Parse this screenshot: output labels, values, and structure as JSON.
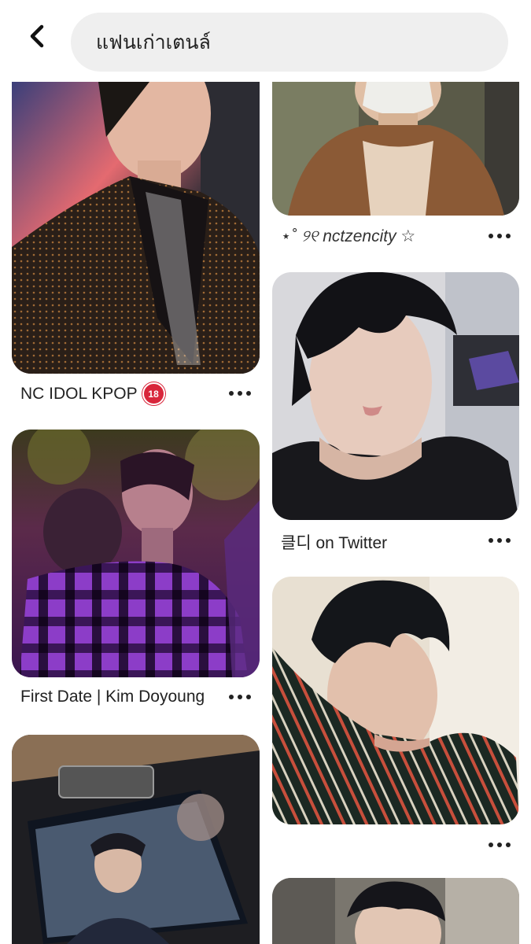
{
  "search": {
    "query": "แฟนเก่าเตนล์"
  },
  "icons": {
    "back": "back-arrow-icon",
    "more": "more-dots-icon"
  },
  "pins": [
    {
      "caption": "NC IDOL KPOP",
      "badge": "18"
    },
    {
      "caption": "⋆˚ ୨୧ nctzencity ☆"
    },
    {
      "caption": "클디 on Twitter"
    },
    {
      "caption": "First Date | Kim Doyoung"
    }
  ]
}
